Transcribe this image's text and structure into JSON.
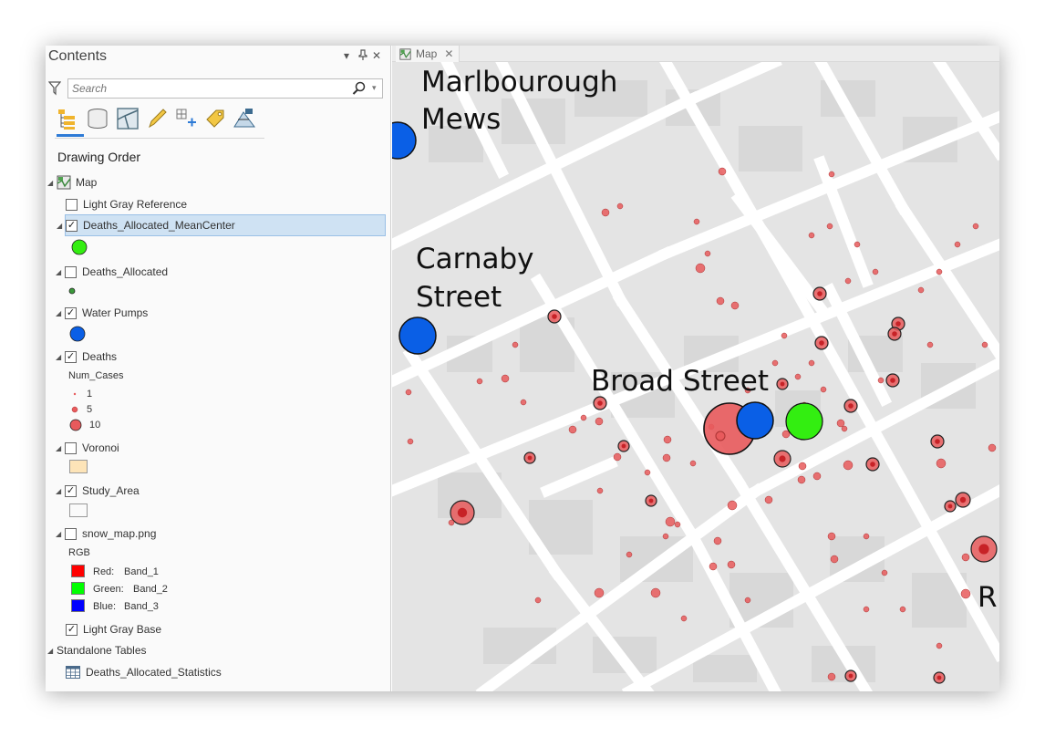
{
  "contents": {
    "title": "Contents",
    "search_placeholder": "Search",
    "heading": "Drawing Order",
    "view_tools": [
      "list-by-drawing-order-icon",
      "list-by-data-source-icon",
      "list-by-selection-icon",
      "list-by-editing-icon",
      "list-by-snapping-icon",
      "list-by-labeling-icon",
      "list-by-perspective-imagery-icon"
    ],
    "map_label": "Map",
    "layers": [
      {
        "name": "Light Gray Reference",
        "checked": false
      },
      {
        "name": "Deaths_Allocated_MeanCenter",
        "checked": true,
        "selected": true
      },
      {
        "name": "Deaths_Allocated",
        "checked": false
      },
      {
        "name": "Water Pumps",
        "checked": true
      },
      {
        "name": "Deaths",
        "checked": true
      },
      {
        "name": "Voronoi",
        "checked": false
      },
      {
        "name": "Study_Area",
        "checked": true
      },
      {
        "name": "snow_map.png",
        "checked": false
      },
      {
        "name": "Light Gray Base",
        "checked": true
      }
    ],
    "deaths_field": "Num_Cases",
    "deaths_classes": [
      "1",
      "5",
      "10"
    ],
    "raster_header": "RGB",
    "raster_bands": [
      {
        "channel": "Red:",
        "band": "Band_1",
        "color": "#ff0000"
      },
      {
        "channel": "Green:",
        "band": "Band_2",
        "color": "#00ff00"
      },
      {
        "channel": "Blue:",
        "band": "Band_3",
        "color": "#0000ff"
      }
    ],
    "standalone_header": "Standalone Tables",
    "table_name": "Deaths_Allocated_Statistics"
  },
  "map": {
    "tab_label": "Map",
    "labels": [
      "Marlbourough",
      "Mews",
      "Carnaby",
      "Street",
      "Broad Street",
      "R"
    ]
  },
  "colors": {
    "accent": "#2e7bd6",
    "mean_center": "#33ee11",
    "water_pump": "#0a5fe6",
    "death": "#e85a5c",
    "voronoi": "#fde4b8",
    "map_bg": "#e4e4e4",
    "block": "#d8d8d8",
    "street": "#ffffff"
  }
}
